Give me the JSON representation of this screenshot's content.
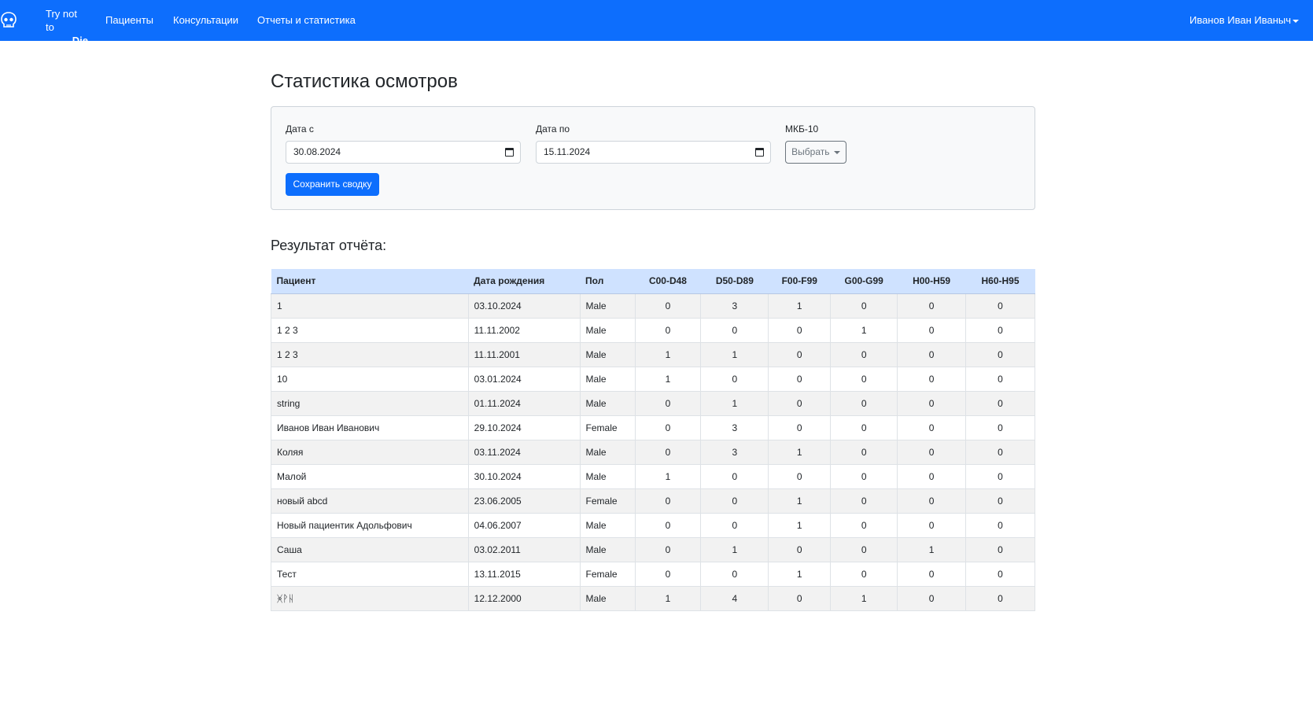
{
  "navbar": {
    "brand_line1": "Try not to",
    "brand_line2": "Die",
    "brand_icon": "skull-icon",
    "links": [
      "Пациенты",
      "Консультации",
      "Отчеты и статистика"
    ],
    "user": "Иванов Иван Иваныч",
    "color": "#0d6efd"
  },
  "page": {
    "title": "Статистика осмотров"
  },
  "filters": {
    "date_from_label": "Дата с",
    "date_from_value": "30.08.2024",
    "date_to_label": "Дата по",
    "date_to_value": "15.11.2024",
    "icd_label": "МКБ-10",
    "icd_button": "Выбрать",
    "save_button": "Сохранить сводку"
  },
  "report": {
    "title": "Результат отчёта:",
    "columns": [
      "Пациент",
      "Дата рождения",
      "Пол",
      "C00-D48",
      "D50-D89",
      "F00-F99",
      "G00-G99",
      "H00-H59",
      "H60-H95"
    ],
    "rows": [
      [
        "1",
        "03.10.2024",
        "Male",
        "0",
        "3",
        "1",
        "0",
        "0",
        "0"
      ],
      [
        "1 2 3",
        "11.11.2002",
        "Male",
        "0",
        "0",
        "0",
        "1",
        "0",
        "0"
      ],
      [
        "1 2 3",
        "11.11.2001",
        "Male",
        "1",
        "1",
        "0",
        "0",
        "0",
        "0"
      ],
      [
        "10",
        "03.01.2024",
        "Male",
        "1",
        "0",
        "0",
        "0",
        "0",
        "0"
      ],
      [
        "string",
        "01.11.2024",
        "Male",
        "0",
        "1",
        "0",
        "0",
        "0",
        "0"
      ],
      [
        "Иванов Иван Иванович",
        "29.10.2024",
        "Female",
        "0",
        "3",
        "0",
        "0",
        "0",
        "0"
      ],
      [
        "Коляя",
        "03.11.2024",
        "Male",
        "0",
        "3",
        "1",
        "0",
        "0",
        "0"
      ],
      [
        "Малой",
        "30.10.2024",
        "Male",
        "1",
        "0",
        "0",
        "0",
        "0",
        "0"
      ],
      [
        "новый abcd",
        "23.06.2005",
        "Female",
        "0",
        "0",
        "1",
        "0",
        "0",
        "0"
      ],
      [
        "Новый пациентик Адольфович",
        "04.06.2007",
        "Male",
        "0",
        "0",
        "1",
        "0",
        "0",
        "0"
      ],
      [
        "Саша",
        "03.02.2011",
        "Male",
        "0",
        "1",
        "0",
        "0",
        "1",
        "0"
      ],
      [
        "Тест",
        "13.11.2015",
        "Female",
        "0",
        "0",
        "1",
        "0",
        "0",
        "0"
      ],
      [
        "ᚸᚹᚺ",
        "12.12.2000",
        "Male",
        "1",
        "4",
        "0",
        "1",
        "0",
        "0"
      ]
    ]
  }
}
